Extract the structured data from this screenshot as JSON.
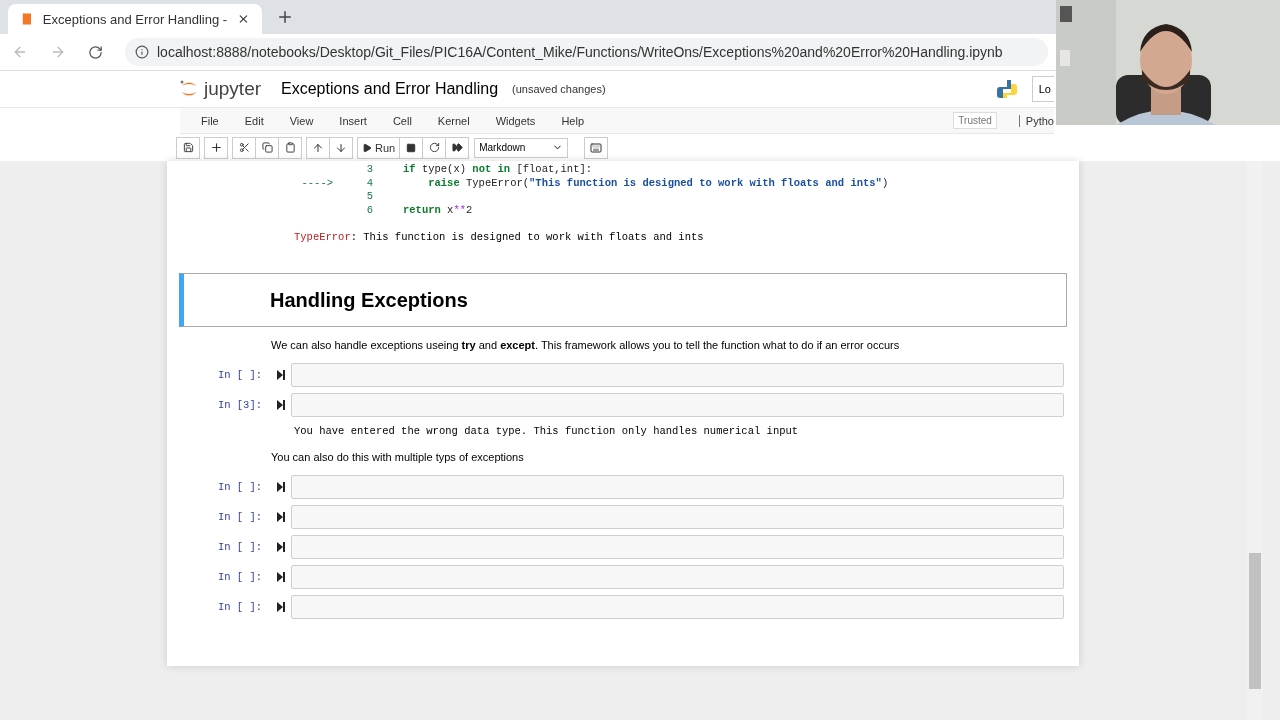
{
  "browser": {
    "tab": {
      "title": "Exceptions and Error Handling -"
    },
    "url": "localhost:8888/notebooks/Desktop/Git_Files/PIC16A/Content_Mike/Functions/WriteOns/Exceptions%20and%20Error%20Handling.ipynb"
  },
  "header": {
    "logo": "jupyter",
    "title": "Exceptions and Error Handling",
    "status": "(unsaved changes)",
    "logout": "Lo"
  },
  "menu": [
    "File",
    "Edit",
    "View",
    "Insert",
    "Cell",
    "Kernel",
    "Widgets",
    "Help"
  ],
  "trusted": "Trusted",
  "kernel": "Pytho",
  "toolbar": {
    "run": "Run",
    "cell_type": "Markdown"
  },
  "traceback": {
    "lines": [
      {
        "number": "3",
        "code": [
          {
            "kind": "keyword",
            "text": "if"
          },
          {
            "kind": "plain",
            "text": " type(x) "
          },
          {
            "kind": "keyword",
            "text": "not in"
          },
          {
            "kind": "plain",
            "text": " [float,int]:"
          }
        ]
      },
      {
        "marker": "---->",
        "number": "4",
        "indented": true,
        "code": [
          {
            "kind": "keyword",
            "text": "raise"
          },
          {
            "kind": "plain",
            "text": " TypeError("
          },
          {
            "kind": "string",
            "text": "\"This function is designed to work with floats and ints\""
          },
          {
            "kind": "plain",
            "text": ")"
          }
        ]
      },
      {
        "number": "5"
      },
      {
        "number": "6",
        "code": [
          {
            "kind": "keyword",
            "text": "return"
          },
          {
            "kind": "plain",
            "text": " x"
          },
          {
            "kind": "op",
            "text": "**"
          },
          {
            "kind": "plain",
            "text": "2"
          }
        ]
      }
    ],
    "error_name": "TypeError",
    "error_message": ": This function is designed to work with floats and ints"
  },
  "cells": [
    {
      "kind": "heading",
      "text": "Handling Exceptions",
      "selected": true
    },
    {
      "kind": "markdown",
      "text": "We can also handle exceptions useing **try** and **except**. This framework allows you to tell the function what to do if an error occurs"
    },
    {
      "kind": "code",
      "prompt": "In [ ]:"
    },
    {
      "kind": "code",
      "prompt": "In [3]:",
      "output": "You have entered the wrong data type. This function only handles numerical input"
    },
    {
      "kind": "markdown",
      "text": "You can also do this with multiple typs of exceptions"
    },
    {
      "kind": "code",
      "prompt": "In [ ]:"
    },
    {
      "kind": "code",
      "prompt": "In [ ]:"
    },
    {
      "kind": "code",
      "prompt": "In [ ]:"
    },
    {
      "kind": "code",
      "prompt": "In [ ]:"
    },
    {
      "kind": "code",
      "prompt": "In [ ]:"
    }
  ]
}
